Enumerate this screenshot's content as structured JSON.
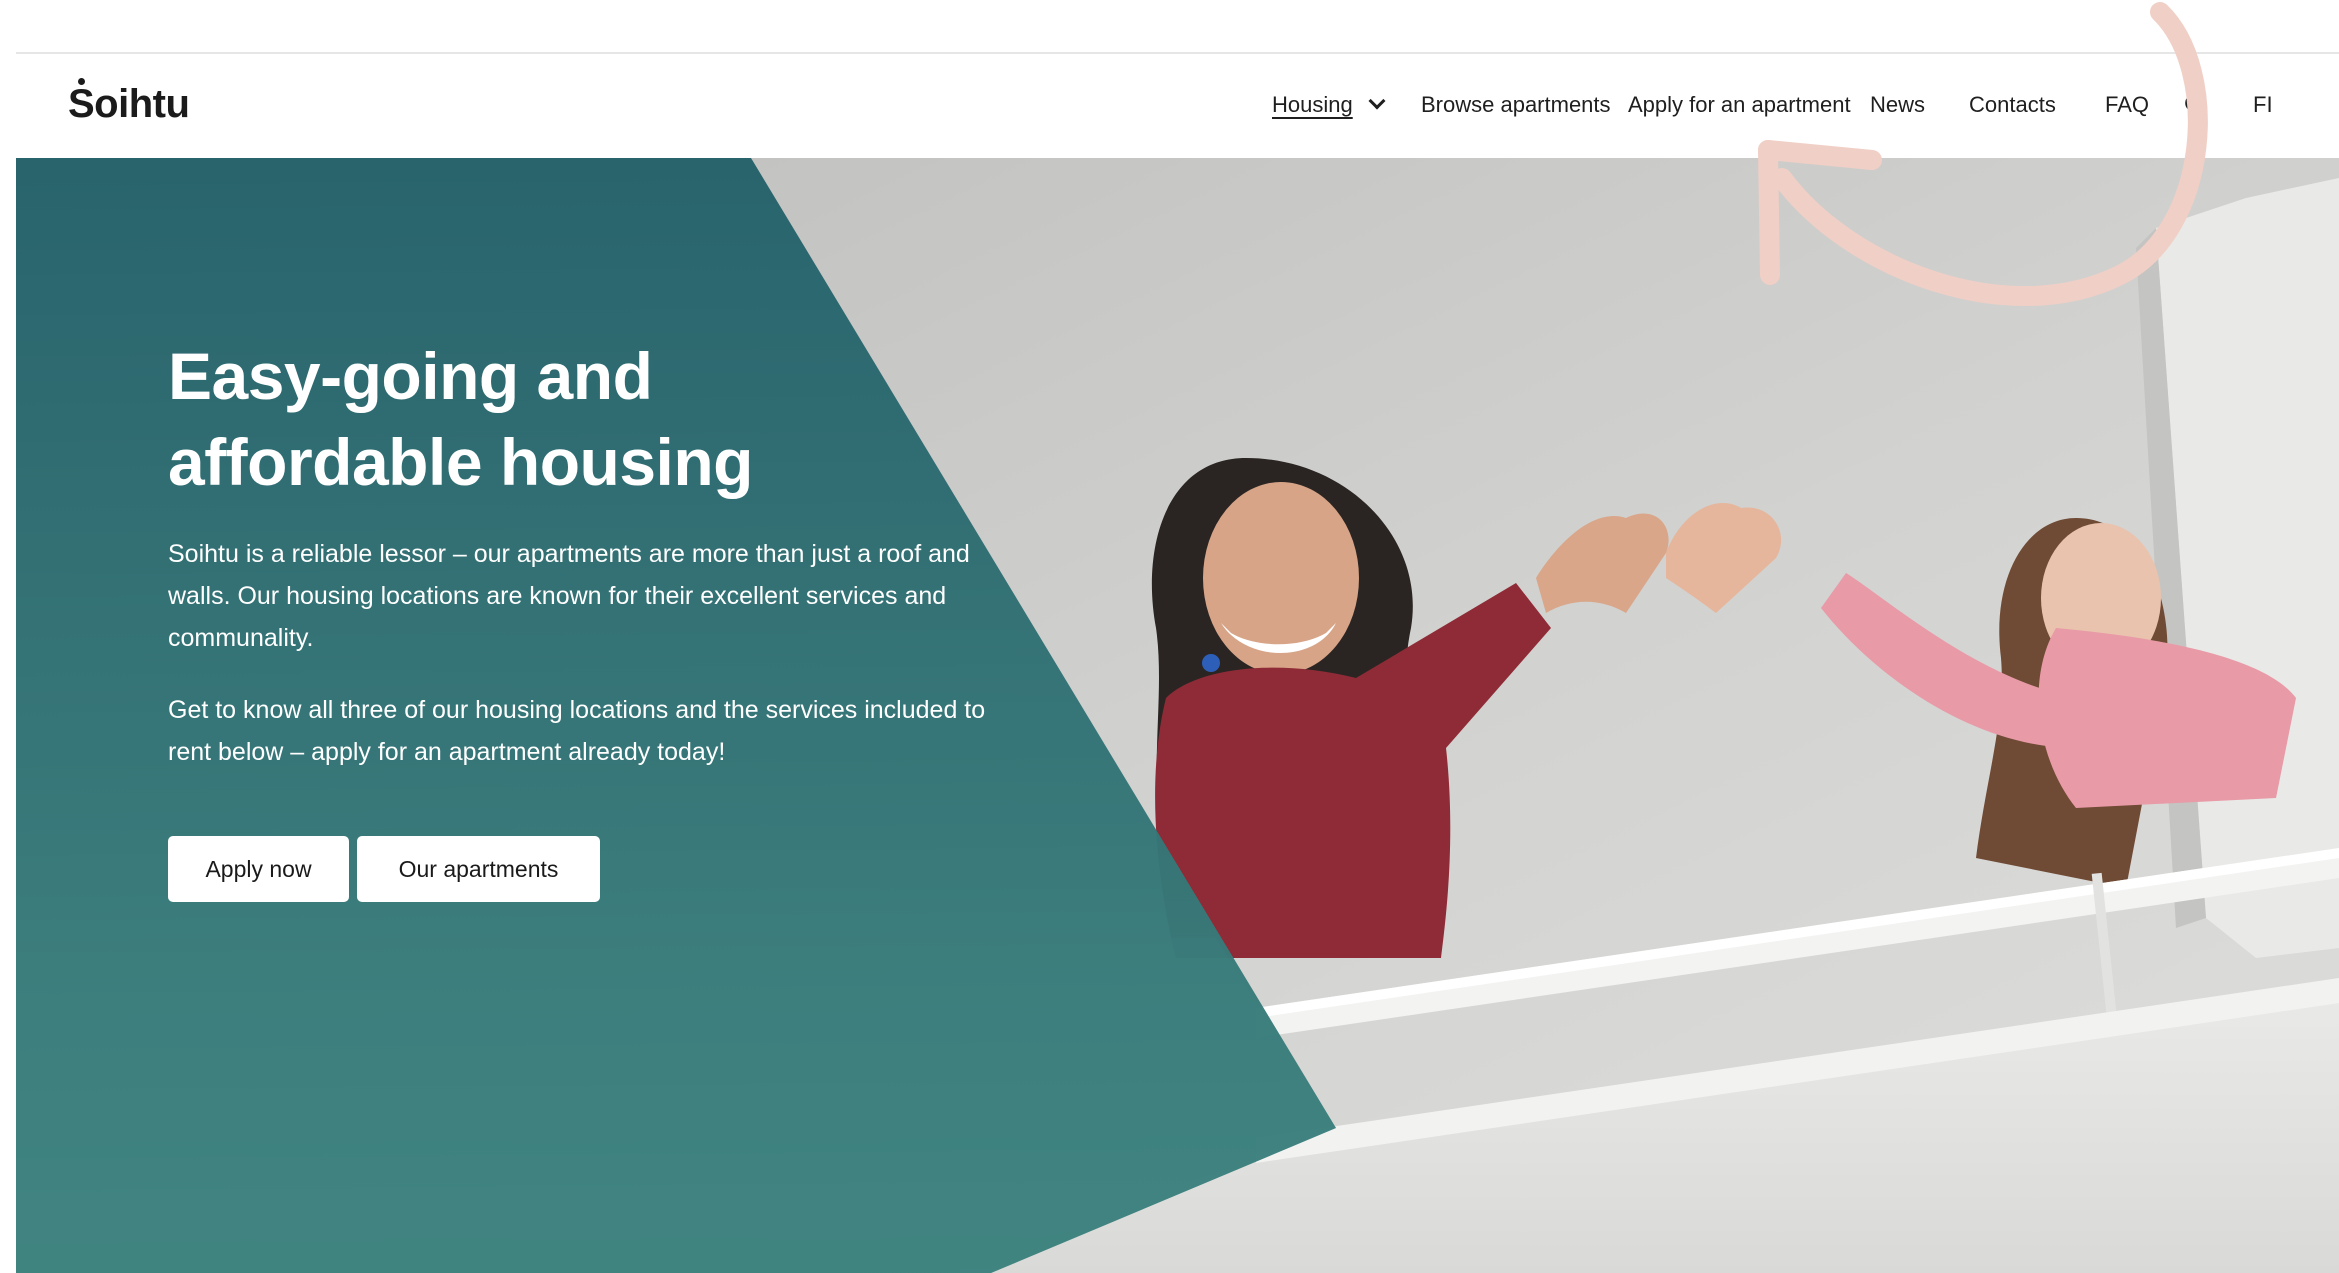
{
  "header": {
    "logo_text": "Soihtu",
    "nav": {
      "housing": "Housing",
      "browse": "Browse apartments",
      "apply": "Apply for an apartment",
      "news": "News",
      "contacts": "Contacts",
      "faq": "FAQ",
      "language": "FI"
    }
  },
  "hero": {
    "title_line1": "Easy-going and",
    "title_line2": "affordable housing",
    "paragraph1": "Soihtu is a reliable lessor – our apartments are more than just a roof and walls. Our housing locations are known for their excellent services and communality.",
    "paragraph2": "Get to know all three of our housing locations and the services included to rent below – apply for an apartment already today!",
    "apply_button": "Apply now",
    "apartments_button": "Our apartments"
  },
  "colors": {
    "teal_panel": "#2b6b72",
    "annotation_arrow": "#f0cfc6"
  },
  "icons": {
    "housing_dropdown": "chevron-down-icon",
    "search": "search-icon"
  }
}
